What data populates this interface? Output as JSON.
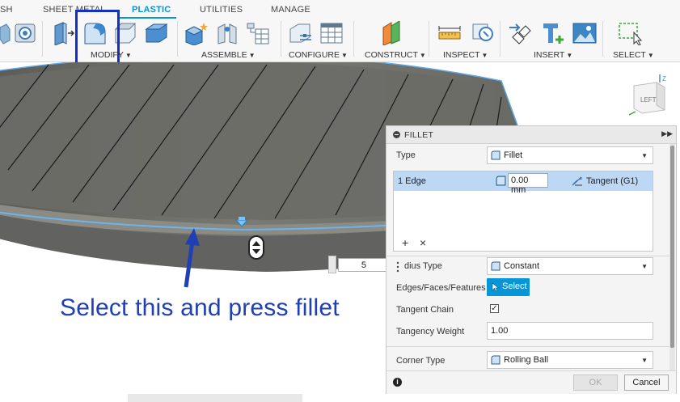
{
  "tabs": [
    {
      "label": "SH"
    },
    {
      "label": "SHEET METAL"
    },
    {
      "label": "PLASTIC"
    },
    {
      "label": "UTILITIES"
    },
    {
      "label": "MANAGE"
    }
  ],
  "groups": {
    "modify": "MODIFY",
    "assemble": "ASSEMBLE",
    "configure": "CONFIGURE",
    "construct": "CONSTRUCT",
    "inspect": "INSPECT",
    "insert": "INSERT",
    "select": "SELECT"
  },
  "annotation": "Select this and press fillet",
  "viewcube_label": "LEFT",
  "viewcube_axis": "Z",
  "radius_input_value": "5",
  "fillet": {
    "title": "FILLET",
    "type_label": "Type",
    "type_value": "Fillet",
    "edge_count": "1 Edge",
    "edge_size": "0.00 mm",
    "edge_tangency": "Tangent (G1)",
    "add_symbol": "+",
    "remove_symbol": "×",
    "radius_type_label": "dius Type",
    "radius_type_value": "Constant",
    "edges_label": "Edges/Faces/Features",
    "select_button": "Select",
    "tangent_chain_label": "Tangent Chain",
    "tangent_chain_checked": true,
    "tangency_weight_label": "Tangency Weight",
    "tangency_weight_value": "1.00",
    "corner_type_label": "Corner Type",
    "corner_type_value": "Rolling Ball",
    "ok_label": "OK",
    "cancel_label": "Cancel"
  },
  "colors": {
    "accent": "#0696d7",
    "highlight_box": "#1030c8",
    "annotation": "#1f3fb5",
    "model_fill": "#6f6f6a",
    "selected_row": "#bcd8f5"
  }
}
